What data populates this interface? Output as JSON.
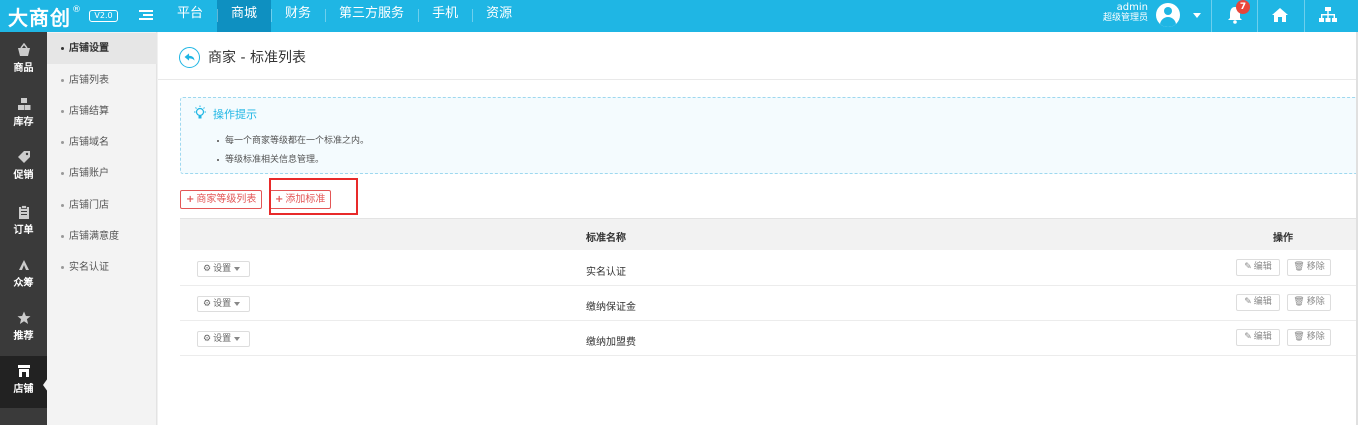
{
  "header": {
    "logo": "大商创",
    "logo_mark": "®",
    "version": "V2.0",
    "nav": [
      "平台",
      "商城",
      "财务",
      "第三方服务",
      "手机",
      "资源"
    ],
    "active_nav": "商城",
    "user_name": "admin",
    "user_role": "超级管理员",
    "notification_count": "7",
    "icons": [
      "menu-toggle-icon",
      "avatar-icon",
      "chevron-down-icon",
      "bell-icon",
      "home-icon",
      "sitemap-icon"
    ]
  },
  "iconbar": {
    "items": [
      {
        "label": "商品",
        "icon": "basket-icon"
      },
      {
        "label": "库存",
        "icon": "cubes-icon"
      },
      {
        "label": "促销",
        "icon": "tag-icon"
      },
      {
        "label": "订单",
        "icon": "clipboard-icon"
      },
      {
        "label": "众筹",
        "icon": "people-icon"
      },
      {
        "label": "推荐",
        "icon": "star-icon"
      },
      {
        "label": "店铺",
        "icon": "store-icon"
      }
    ],
    "active": "店铺"
  },
  "submenu": {
    "items": [
      "店铺设置",
      "店铺列表",
      "店铺结算",
      "店铺域名",
      "店铺账户",
      "店铺门店",
      "店铺满意度",
      "实名认证"
    ],
    "active": "店铺设置"
  },
  "page": {
    "title": "商家 - 标准列表"
  },
  "tips": {
    "title": "操作提示",
    "lines": [
      "每一个商家等级都在一个标准之内。",
      "等级标准相关信息管理。"
    ]
  },
  "actions": {
    "grade_list": "商家等级列表",
    "add_standard": "添加标准"
  },
  "table": {
    "headers": [
      "标准名称",
      "操作"
    ],
    "setting_label": "设置",
    "edit_label": "编辑",
    "remove_label": "移除",
    "rows": [
      {
        "name": "实名认证"
      },
      {
        "name": "缴纳保证金"
      },
      {
        "name": "缴纳加盟费"
      }
    ]
  },
  "colors": {
    "accent": "#1fb6e4",
    "active_nav": "#0e90c1",
    "danger": "#e35656",
    "sidebar": "#3a3a3a"
  }
}
